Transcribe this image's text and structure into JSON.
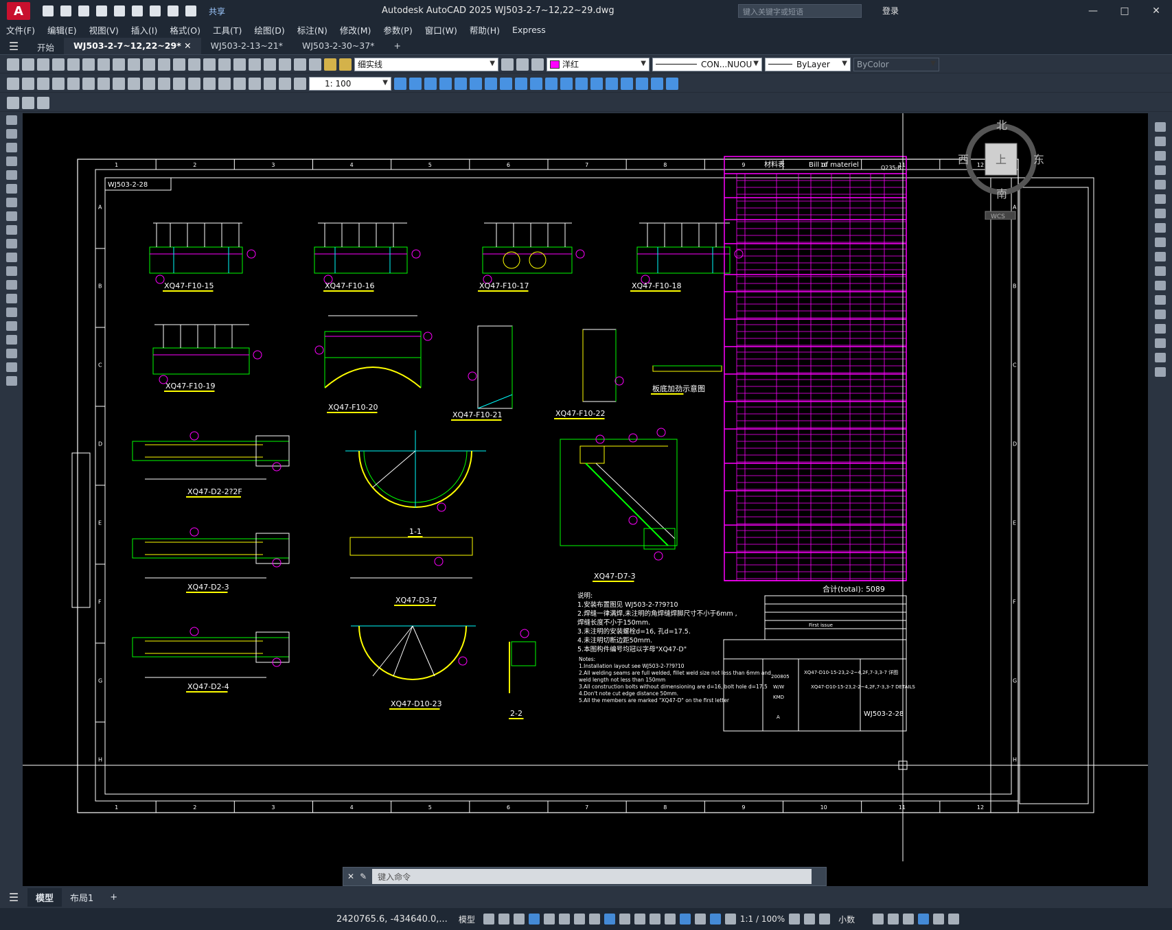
{
  "app": {
    "title": "Autodesk AutoCAD 2025    WJ503-2-7~12,22~29.dwg",
    "search_placeholder": "键入关键字或短语",
    "login": "登录",
    "share": "共享",
    "logo": "A"
  },
  "menu": [
    "文件(F)",
    "编辑(E)",
    "视图(V)",
    "插入(I)",
    "格式(O)",
    "工具(T)",
    "绘图(D)",
    "标注(N)",
    "修改(M)",
    "参数(P)",
    "窗口(W)",
    "帮助(H)",
    "Express"
  ],
  "tabs": [
    {
      "label": "开始"
    },
    {
      "label": "WJ503-2-7~12,22~29*"
    },
    {
      "label": "WJ503-2-13~21*"
    },
    {
      "label": "WJ503-2-30~37*"
    }
  ],
  "toolbar": {
    "linetype": "细实线",
    "color": "洋红",
    "linetype2": "CON...NUOU",
    "lineweight": "ByLayer",
    "plotstyle": "ByColor",
    "scale": "1: 100"
  },
  "viewcube": {
    "north": "北",
    "south": "南",
    "west": "西",
    "east": "东",
    "top": "上",
    "wcs": "WCS"
  },
  "drawing": {
    "sheet_id": "WJ503-2-28",
    "sheet_id_mirror": "WJ503-2-28",
    "bom_title": "Bill of materiel",
    "bom_title_cn": "材料表",
    "bom_code": "Q235-B",
    "total": "合计(total): 5089",
    "col_numbers": [
      "1",
      "2",
      "3",
      "4",
      "5",
      "6",
      "7",
      "8",
      "9",
      "10",
      "11",
      "12"
    ],
    "row_letters": [
      "A",
      "B",
      "C",
      "D",
      "E",
      "F",
      "G",
      "H"
    ],
    "labels": [
      "XQ47-F10-15",
      "XQ47-F10-16",
      "XQ47-F10-17",
      "XQ47-F10-18",
      "XQ47-F10-19",
      "XQ47-F10-20",
      "XQ47-F10-21",
      "XQ47-F10-22",
      "板底加劲示意图",
      "XQ47-D2-2?2F",
      "1-1",
      "XQ47-D7-3",
      "XQ47-D2-3",
      "XQ47-D3-7",
      "XQ47-D2-4",
      "XQ47-D10-23",
      "2-2"
    ],
    "notes_cn": [
      "说明:",
      "1.安装布置图见 WJ503-2-7?9?10",
      "2.焊缝一律满焊,未注明的角焊缝焊脚尺寸不小于6mm ,",
      "   焊缝长度不小于150mm.",
      "3.未注明的安装螺栓d=16, 孔d=17.5.",
      "4.未注明切断边距50mm.",
      "5.本图构件编号均冠以字母\"XQ47-D\""
    ],
    "notes_en": [
      "Notes:",
      "1.Installation layout see WJ503-2-7?9?10",
      "2.All welding seams are full welded, fillet weld size not less than 6mm and",
      "   weld length not less than 150mm",
      "3.All construction bolts without dimensioning are d=16, bolt hole d=17.5",
      "4.Don't note cut  edge distance 50mm.",
      "5.All the members are marked \"XQ47-D\" on the first letter"
    ],
    "titleblock": {
      "title1": "XQ47-D10-15-23,2-2~4,2F,7-3,3-7 详图",
      "title2": "XQ47-D10-15-23,2-2~4,2F,7-3,3-7 DETAILS",
      "date": "200805",
      "scale": "W/W",
      "stage": "KMD",
      "rev": "A",
      "issue": "First issue"
    }
  },
  "command": {
    "placeholder": "键入命令"
  },
  "layouts": [
    {
      "label": "模型"
    },
    {
      "label": "布局1"
    }
  ],
  "status": {
    "coords": "2420765.6, -434640.0,...",
    "model": "模型",
    "scale": "1:1 / 100%",
    "units": "小数"
  }
}
